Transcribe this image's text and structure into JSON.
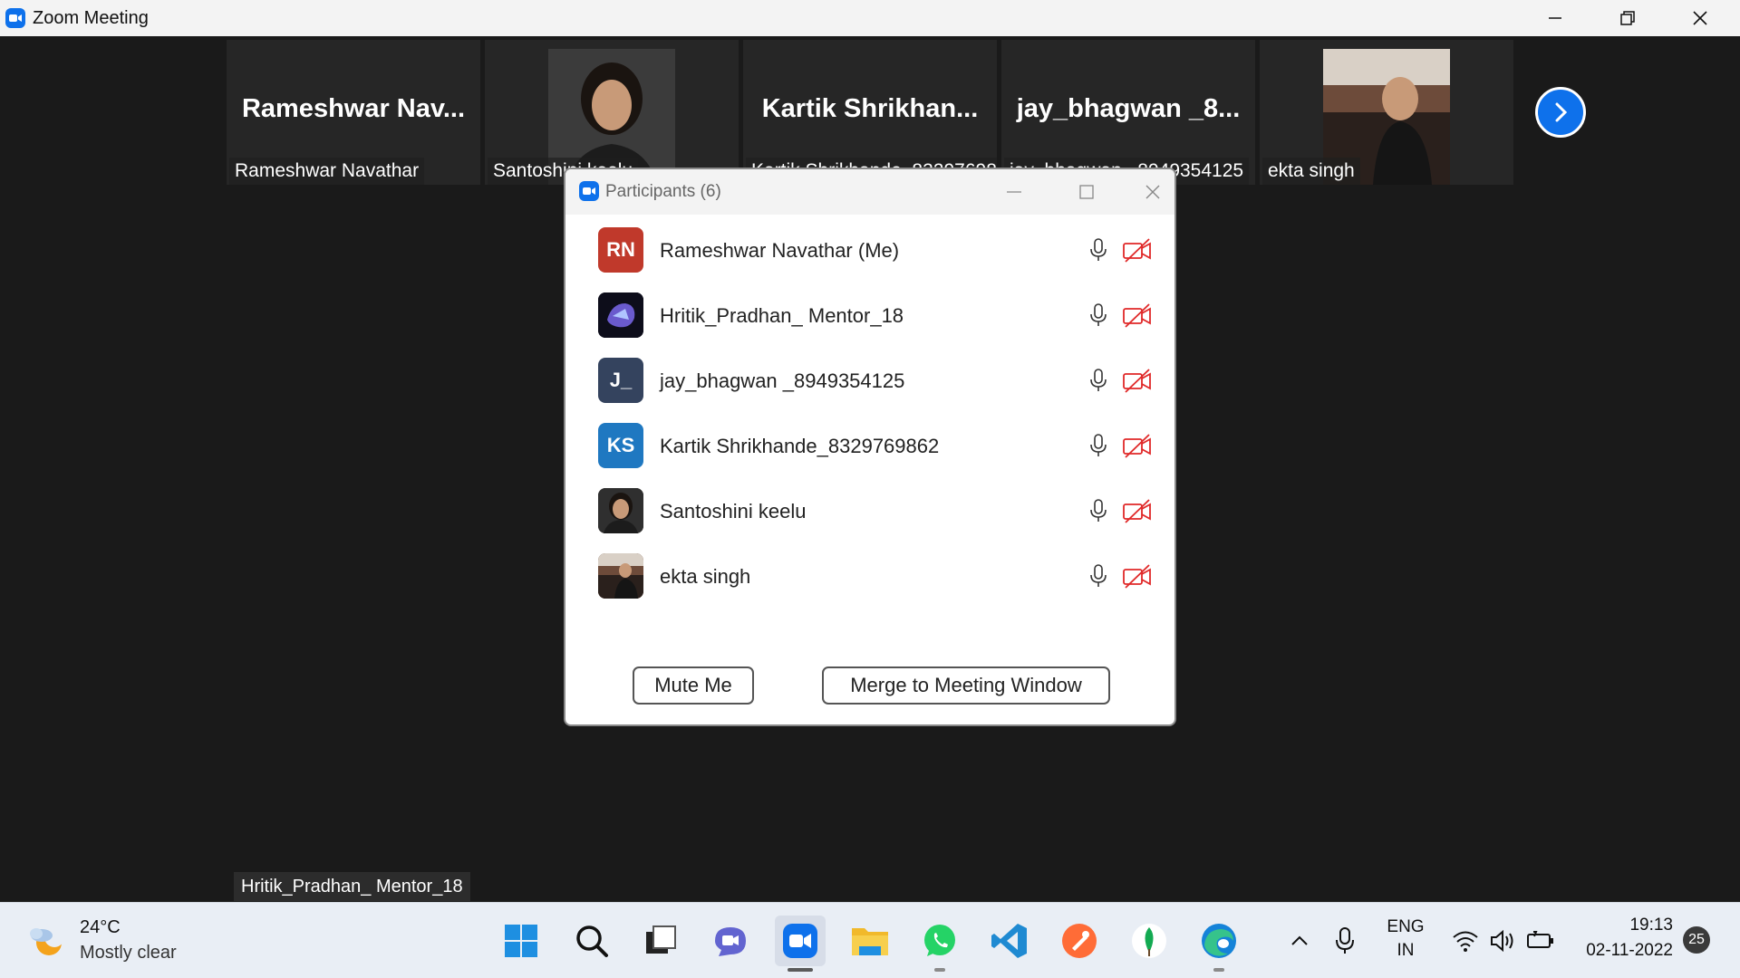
{
  "window": {
    "title": "Zoom Meeting"
  },
  "thumbnails": [
    {
      "big_text": "Rameshwar  Nav...",
      "name": "Rameshwar Navathar"
    },
    {
      "big_text": "",
      "name": "Santoshini keelu"
    },
    {
      "big_text": "Kartik  Shrikhan...",
      "name": "Kartik Shrikhande_8329769862"
    },
    {
      "big_text": "jay_bhagwan  _8...",
      "name": "jay_bhagwan _8949354125"
    },
    {
      "big_text": "",
      "name": "ekta singh"
    }
  ],
  "speaker_label": "Hritik_Pradhan_ Mentor_18",
  "dialog": {
    "title": "Participants (6)",
    "participants": [
      {
        "initials": "RN",
        "name": "Rameshwar Navathar (Me)",
        "avatar_color": "#c0392b"
      },
      {
        "initials": "",
        "name": "Hritik_Pradhan_ Mentor_18",
        "avatar_color": "#1b1b2e"
      },
      {
        "initials": "J_",
        "name": "jay_bhagwan _8949354125",
        "avatar_color": "#34435e"
      },
      {
        "initials": "KS",
        "name": "Kartik Shrikhande_8329769862",
        "avatar_color": "#1f78c1"
      },
      {
        "initials": "",
        "name": "Santoshini keelu",
        "avatar_color": "#3a2a22"
      },
      {
        "initials": "",
        "name": "ekta singh",
        "avatar_color": "#6b4a3a"
      }
    ],
    "mute_label": "Mute Me",
    "merge_label": "Merge to Meeting Window"
  },
  "taskbar": {
    "weather_temp": "24°C",
    "weather_desc": "Mostly clear",
    "lang_top": "ENG",
    "lang_bottom": "IN",
    "time": "19:13",
    "date": "02-11-2022",
    "notification_count": "25"
  },
  "colors": {
    "zoom_blue": "#0e71eb",
    "video_off_red": "#e02828"
  }
}
